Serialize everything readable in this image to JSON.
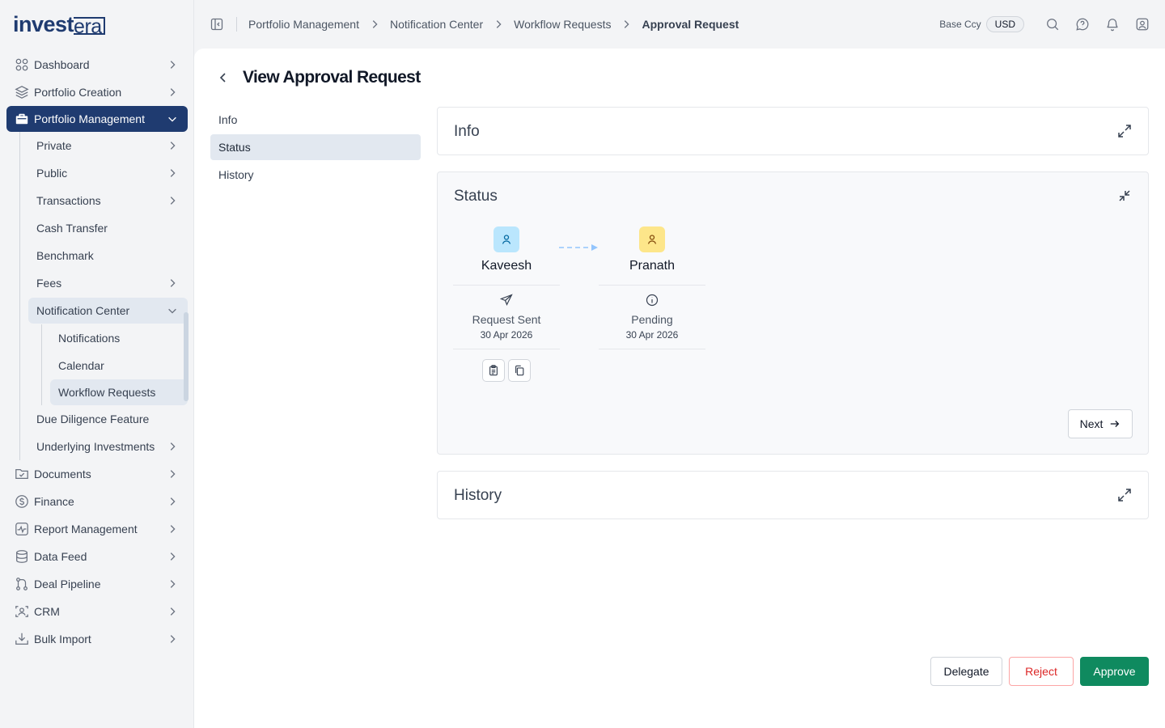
{
  "brand": {
    "logo_main": "invest",
    "logo_accent": "era"
  },
  "sidebar": {
    "items": [
      {
        "label": "Dashboard",
        "icon": "grid-icon"
      },
      {
        "label": "Portfolio Creation",
        "icon": "layers-icon"
      },
      {
        "label": "Portfolio Management",
        "icon": "briefcase-icon"
      },
      {
        "label": "Documents",
        "icon": "folder-check-icon"
      },
      {
        "label": "Finance",
        "icon": "dollar-circle-icon"
      },
      {
        "label": "Report Management",
        "icon": "activity-icon"
      },
      {
        "label": "Data Feed",
        "icon": "database-icon"
      },
      {
        "label": "Deal Pipeline",
        "icon": "git-branch-icon"
      },
      {
        "label": "CRM",
        "icon": "user-scan-icon"
      },
      {
        "label": "Bulk Import",
        "icon": "download-tray-icon"
      }
    ],
    "portfolio_management_children": [
      {
        "label": "Private"
      },
      {
        "label": "Public"
      },
      {
        "label": "Transactions"
      },
      {
        "label": "Cash Transfer"
      },
      {
        "label": "Benchmark"
      },
      {
        "label": "Fees"
      },
      {
        "label": "Notification Center"
      },
      {
        "label": "Due Diligence Feature"
      },
      {
        "label": "Underlying Investments"
      }
    ],
    "notification_center_children": [
      {
        "label": "Notifications"
      },
      {
        "label": "Calendar"
      },
      {
        "label": "Workflow Requests"
      }
    ]
  },
  "topbar": {
    "breadcrumbs": [
      "Portfolio Management",
      "Notification Center",
      "Workflow Requests",
      "Approval Request"
    ],
    "base_ccy_label": "Base Ccy",
    "base_ccy_value": "USD"
  },
  "page": {
    "title": "View Approval Request",
    "tabs": [
      "Info",
      "Status",
      "History"
    ],
    "active_tab": "Status"
  },
  "sections": {
    "info": {
      "title": "Info"
    },
    "status": {
      "title": "Status",
      "next_label": "Next",
      "flow": [
        {
          "name": "Kaveesh",
          "status": "Request Sent",
          "date": "30 Apr 2026",
          "avatar_color": "#bae6fd",
          "avatar_icon_color": "#0369a1"
        },
        {
          "name": "Pranath",
          "status": "Pending",
          "date": "30 Apr 2026",
          "avatar_color": "#fde68a",
          "avatar_icon_color": "#854d0e"
        }
      ]
    },
    "history": {
      "title": "History"
    }
  },
  "actions": {
    "delegate": "Delegate",
    "reject": "Reject",
    "approve": "Approve"
  },
  "colors": {
    "brand": "#1f3b70",
    "approve": "#0f8a5f",
    "reject": "#dc2626"
  }
}
